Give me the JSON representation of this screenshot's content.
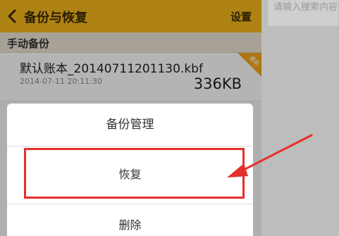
{
  "header": {
    "title": "备份与恢复",
    "settings_label": "设置"
  },
  "section": {
    "label": "手动备份"
  },
  "backup_item": {
    "filename": "默认账本_20140711201130.kbf",
    "date": "2014-07-11 20:11:30",
    "size": "336KB",
    "badge": "最新"
  },
  "dialog": {
    "title": "备份管理",
    "restore_label": "恢复",
    "delete_label": "删除"
  },
  "search": {
    "placeholder": "请输入搜索内容"
  },
  "colors": {
    "accent": "#f2b51b",
    "highlight": "#e4312b"
  }
}
